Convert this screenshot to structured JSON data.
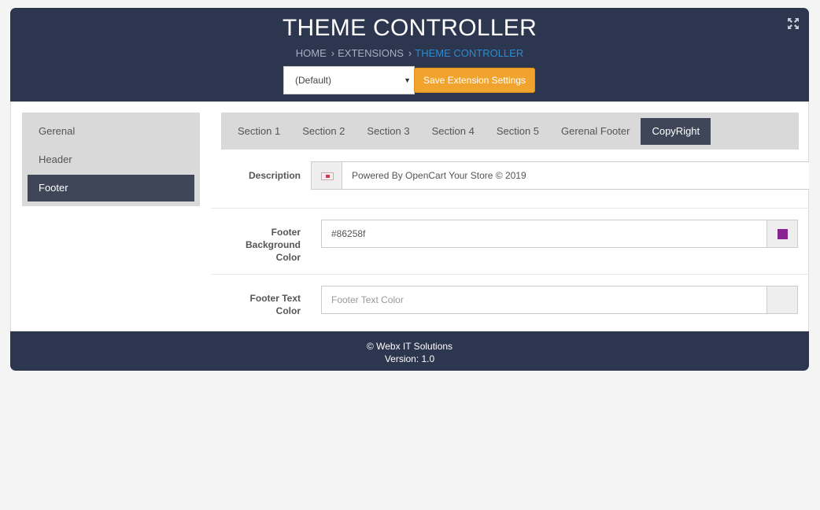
{
  "header": {
    "title": "THEME CONTROLLER",
    "breadcrumb": [
      "HOME",
      "EXTENSIONS",
      "THEME CONTROLLER"
    ],
    "breadcrumb_separator": "›"
  },
  "toolbar": {
    "store_select_value": "(Default)",
    "save_label": "Save Extension Settings"
  },
  "sidebar": {
    "items": [
      {
        "label": "Gerenal",
        "active": false
      },
      {
        "label": "Header",
        "active": false
      },
      {
        "label": "Footer",
        "active": true
      }
    ]
  },
  "tabs": [
    {
      "label": "Section 1",
      "active": false
    },
    {
      "label": "Section 2",
      "active": false
    },
    {
      "label": "Section 3",
      "active": false
    },
    {
      "label": "Section 4",
      "active": false
    },
    {
      "label": "Section 5",
      "active": false
    },
    {
      "label": "Gerenal Footer",
      "active": false
    },
    {
      "label": "CopyRight",
      "active": true
    }
  ],
  "form": {
    "description": {
      "label": "Description",
      "value": "Powered By OpenCart Your Store © 2019",
      "flag_icon": "language-flag-icon"
    },
    "footer_bg_color": {
      "label_lines": [
        "Footer",
        "Background",
        "Color"
      ],
      "value": "#86258f",
      "swatch_color": "#86258f"
    },
    "footer_text_color": {
      "label_lines": [
        "Footer Text",
        "Color"
      ],
      "placeholder": "Footer Text Color",
      "swatch_color": "#eeeeee"
    }
  },
  "footer": {
    "copyright": "© Webx IT Solutions",
    "version": "Version: 1.0"
  },
  "colors": {
    "header_bg": "#2d364f",
    "accent_orange": "#f1a42d",
    "breadcrumb_active": "#2a8bd1",
    "active_item_bg": "#3e4658"
  }
}
